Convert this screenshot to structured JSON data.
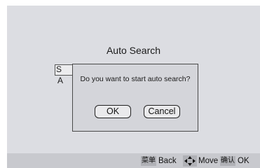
{
  "screen": {
    "title": "Auto Search",
    "background_items": [
      "S",
      "A"
    ]
  },
  "dialog": {
    "message": "Do you want to start auto search?",
    "ok_label": "OK",
    "cancel_label": "Cancel"
  },
  "footer": {
    "back_key": "菜单",
    "back_label": "Back",
    "move_icon": "four-way-arrow-icon",
    "move_label": "Move",
    "ok_key": "确认",
    "ok_label": "OK"
  },
  "colors": {
    "screen_bg": "#dcdde2",
    "dialog_bg": "#d4d5da",
    "footer_bg": "#c8c9ce"
  }
}
